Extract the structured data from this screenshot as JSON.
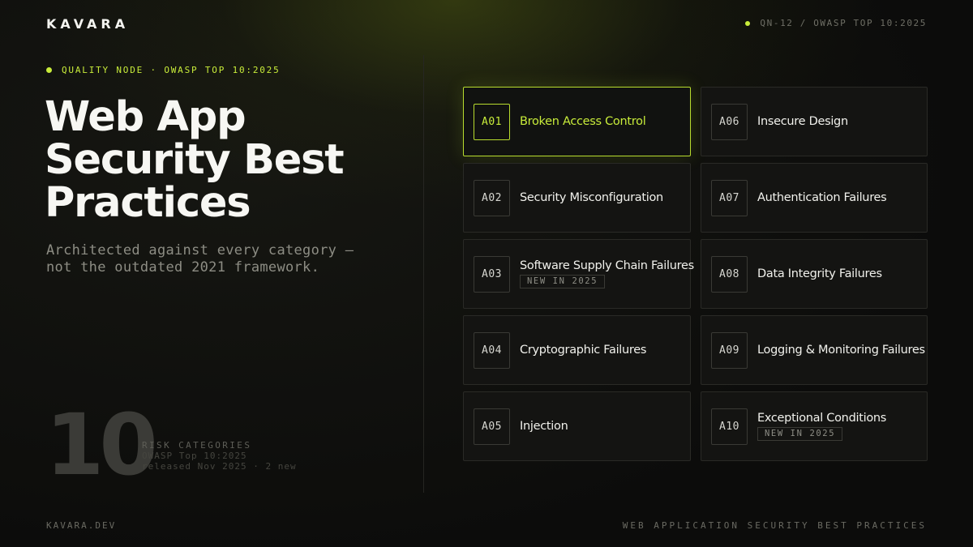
{
  "brand": "KAVARA",
  "top_meta": "QN-12 / OWASP TOP 10:2025",
  "eyebrow": "QUALITY NODE · OWASP TOP 10:2025",
  "headline": "Web App Security Best Practices",
  "subtitle": "Architected against every category — not the outdated 2021 framework.",
  "stat": {
    "number": "10",
    "label": "RISK CATEGORIES",
    "line1": "OWASP Top 10:2025",
    "line2": "released Nov 2025 · 2 new"
  },
  "categories": [
    {
      "code": "A01",
      "title": "Broken Access Control",
      "badge": "",
      "active": true
    },
    {
      "code": "A06",
      "title": "Insecure Design",
      "badge": ""
    },
    {
      "code": "A02",
      "title": "Security Misconfiguration",
      "badge": ""
    },
    {
      "code": "A07",
      "title": "Authentication Failures",
      "badge": ""
    },
    {
      "code": "A03",
      "title": "Software Supply Chain Failures",
      "badge": "NEW IN 2025"
    },
    {
      "code": "A08",
      "title": "Data Integrity Failures",
      "badge": ""
    },
    {
      "code": "A04",
      "title": "Cryptographic Failures",
      "badge": ""
    },
    {
      "code": "A09",
      "title": "Logging & Monitoring Failures",
      "badge": ""
    },
    {
      "code": "A05",
      "title": "Injection",
      "badge": ""
    },
    {
      "code": "A10",
      "title": "Exceptional Conditions",
      "badge": "NEW IN 2025"
    }
  ],
  "footer": {
    "left": "KAVARA.DEV",
    "right": "WEB APPLICATION SECURITY BEST PRACTICES"
  },
  "colors": {
    "accent": "#c8ec3a",
    "background": "#0c0c0b",
    "card": "#141412"
  }
}
